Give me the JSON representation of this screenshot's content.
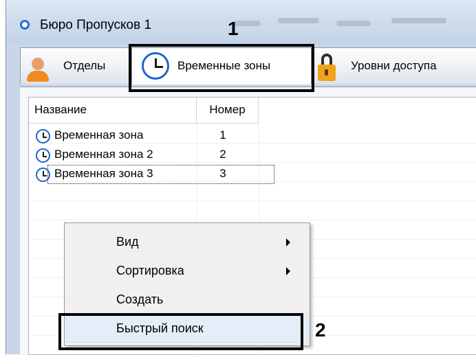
{
  "window": {
    "title": "Бюро Пропусков 1"
  },
  "tabs": [
    {
      "label": "Отделы",
      "icon": "person-icon"
    },
    {
      "label": "Временные зоны",
      "icon": "clock-icon"
    },
    {
      "label": "Уровни доступа",
      "icon": "lock-icon"
    }
  ],
  "list": {
    "columns": [
      "Название",
      "Номер"
    ],
    "rows": [
      {
        "name": "Временная зона",
        "number": "1"
      },
      {
        "name": "Временная зона 2",
        "number": "2"
      },
      {
        "name": "Временная зона 3",
        "number": "3"
      }
    ]
  },
  "context_menu": {
    "items": [
      {
        "label": "Вид",
        "submenu": true
      },
      {
        "label": "Сортировка",
        "submenu": true
      },
      {
        "label": "Создать",
        "submenu": false
      },
      {
        "label": "Быстрый поиск",
        "submenu": false,
        "highlighted": true
      }
    ]
  },
  "annotations": {
    "marker_1": "1",
    "marker_2": "2"
  },
  "colors": {
    "accent": "#1f65c8",
    "window_frame": "#c8d6e8",
    "menu_highlight": "#e5eef8"
  }
}
